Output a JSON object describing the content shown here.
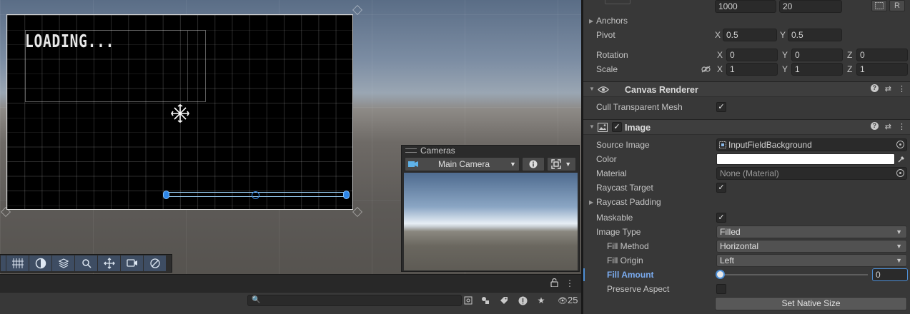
{
  "scene": {
    "loading_text": "LOADING...",
    "cameras_overlay": {
      "title": "Cameras",
      "selected_camera": "Main Camera"
    }
  },
  "console": {
    "search_placeholder": "",
    "message_count": "25"
  },
  "inspector": {
    "size_values": [
      "1000",
      "20"
    ],
    "size_buttons": [
      "",
      "R"
    ],
    "anchors_label": "Anchors",
    "pivot": {
      "label": "Pivot",
      "x": "0.5",
      "y": "0.5"
    },
    "rotation": {
      "label": "Rotation",
      "x": "0",
      "y": "0",
      "z": "0"
    },
    "scale": {
      "label": "Scale",
      "x": "1",
      "y": "1",
      "z": "1"
    },
    "axis_labels": {
      "x": "X",
      "y": "Y",
      "z": "Z"
    },
    "canvas_renderer": {
      "title": "Canvas Renderer",
      "cull_label": "Cull Transparent Mesh",
      "cull_checked": true
    },
    "image": {
      "title": "Image",
      "enabled": true,
      "source_image": {
        "label": "Source Image",
        "value": "InputFieldBackground"
      },
      "color": {
        "label": "Color",
        "value": "#ffffff"
      },
      "material": {
        "label": "Material",
        "value": "None (Material)"
      },
      "raycast_target": {
        "label": "Raycast Target",
        "checked": true
      },
      "raycast_padding_label": "Raycast Padding",
      "maskable": {
        "label": "Maskable",
        "checked": true
      },
      "image_type": {
        "label": "Image Type",
        "value": "Filled"
      },
      "fill_method": {
        "label": "Fill Method",
        "value": "Horizontal"
      },
      "fill_origin": {
        "label": "Fill Origin",
        "value": "Left"
      },
      "fill_amount": {
        "label": "Fill Amount",
        "value": "0",
        "fraction": 0
      },
      "preserve_aspect": {
        "label": "Preserve Aspect",
        "checked": false
      },
      "set_native_size_label": "Set Native Size"
    }
  },
  "colors": {
    "accent": "#4e8fd6",
    "selected_label": "#7bacf0"
  }
}
